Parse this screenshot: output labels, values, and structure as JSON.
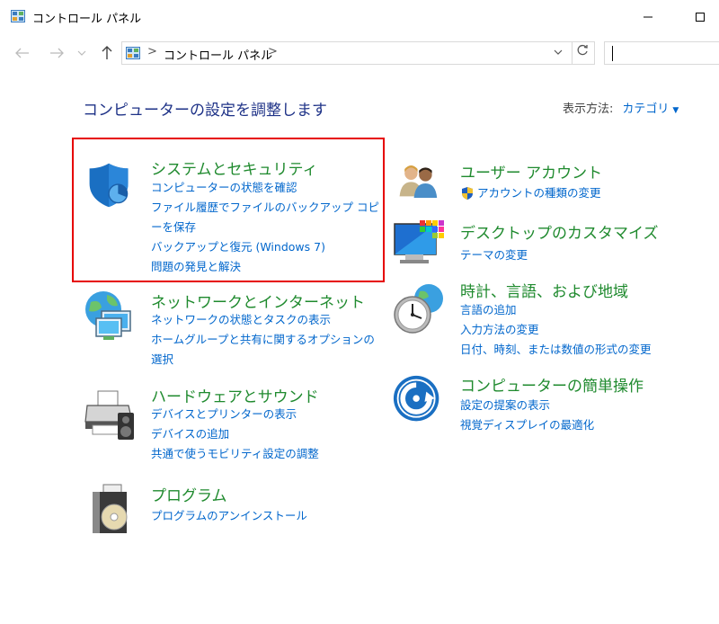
{
  "window": {
    "title": "コントロール パネル"
  },
  "addressbar": {
    "crumb": "コントロール パネル",
    "separator": ">",
    "search_placeholder": ""
  },
  "main": {
    "page_title": "コンピューターの設定を調整します",
    "view_by_label": "表示方法:",
    "view_by_value": "カテゴリ"
  },
  "categories": {
    "system": {
      "title": "システムとセキュリティ",
      "links": [
        "コンピューターの状態を確認",
        "ファイル履歴でファイルのバックアップ コピーを保存",
        "バックアップと復元 (Windows 7)",
        "問題の発見と解決"
      ]
    },
    "network": {
      "title": "ネットワークとインターネット",
      "links": [
        "ネットワークの状態とタスクの表示",
        "ホームグループと共有に関するオプションの選択"
      ]
    },
    "hardware": {
      "title": "ハードウェアとサウンド",
      "links": [
        "デバイスとプリンターの表示",
        "デバイスの追加",
        "共通で使うモビリティ設定の調整"
      ]
    },
    "programs": {
      "title": "プログラム",
      "links": [
        "プログラムのアンインストール"
      ]
    },
    "user": {
      "title": "ユーザー アカウント",
      "links": [
        "アカウントの種類の変更"
      ]
    },
    "desktop": {
      "title": "デスクトップのカスタマイズ",
      "links": [
        "テーマの変更"
      ]
    },
    "clock": {
      "title": "時計、言語、および地域",
      "links": [
        "言語の追加",
        "入力方法の変更",
        "日付、時刻、または数値の形式の変更"
      ]
    },
    "access": {
      "title": "コンピューターの簡単操作",
      "links": [
        "設定の提案の表示",
        "視覚ディスプレイの最適化"
      ]
    }
  },
  "colors": {
    "category_title": "#1f8a2e",
    "link": "#0066cc",
    "page_title": "#1e3287",
    "highlight": "#e60000"
  }
}
